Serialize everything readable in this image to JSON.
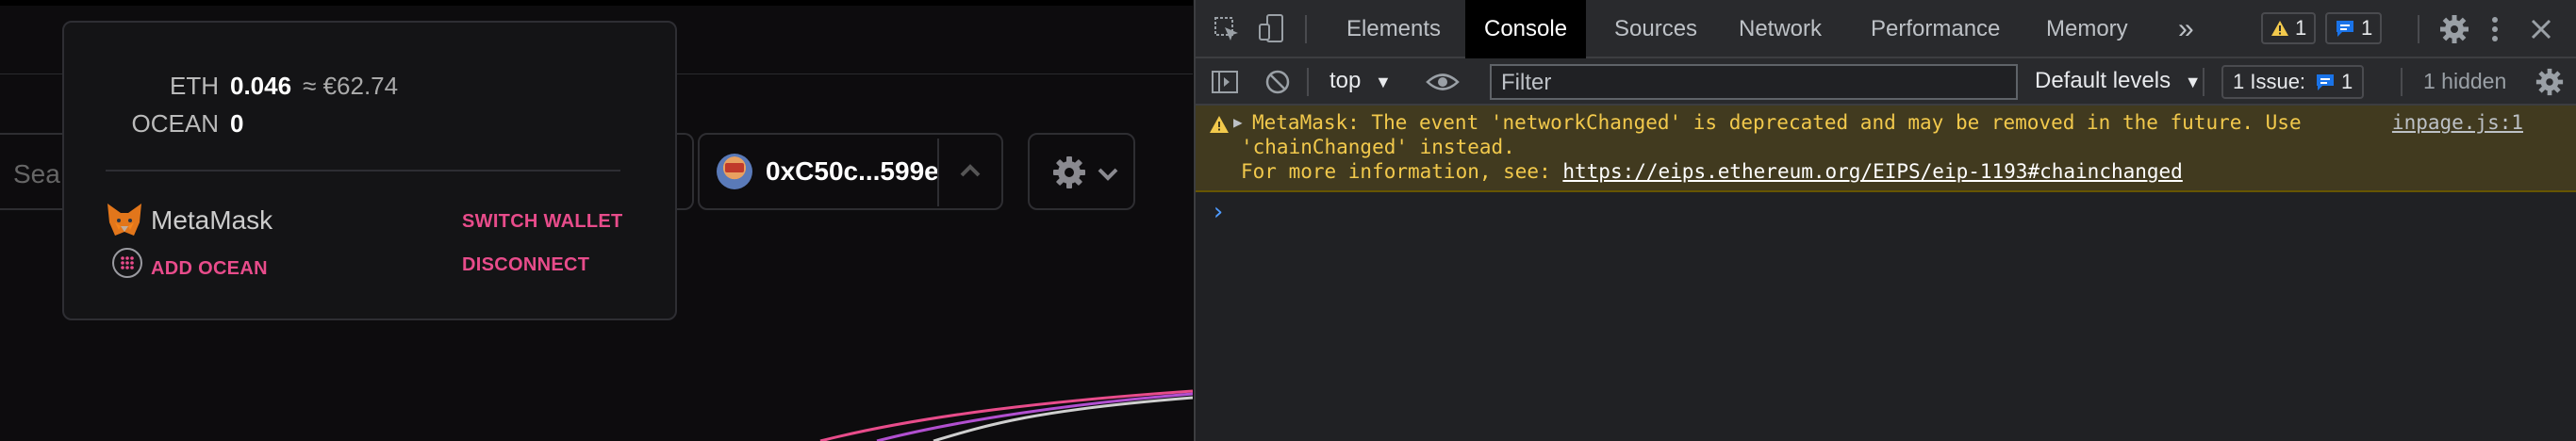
{
  "app": {
    "search_placeholder": "Sea",
    "wallet_button": {
      "address": "0xC50c...599e"
    },
    "wallet_popover": {
      "balances": [
        {
          "symbol": "ETH",
          "amount": "0.046",
          "fiat": "≈ €62.74"
        },
        {
          "symbol": "OCEAN",
          "amount": "0",
          "fiat": ""
        }
      ],
      "provider_name": "MetaMask",
      "add_token_label": "ADD OCEAN",
      "switch_wallet_label": "SWITCH WALLET",
      "disconnect_label": "DISCONNECT"
    },
    "colors": {
      "accent_pink": "#e84c8b",
      "background": "#0d0c0e"
    }
  },
  "devtools": {
    "tabs": [
      "Elements",
      "Console",
      "Sources",
      "Network",
      "Performance",
      "Memory"
    ],
    "active_tab": "Console",
    "more_tabs_label": "»",
    "warnings_count": "1",
    "messages_count": "1",
    "toolbar": {
      "context": "top",
      "filter_placeholder": "Filter",
      "levels": "Default levels",
      "issues_label": "1 Issue:",
      "issues_count": "1",
      "hidden_label": "1 hidden"
    },
    "console": {
      "warning_line1": "MetaMask: The event 'networkChanged' is deprecated and may be removed in the future. Use",
      "warning_line2": "'chainChanged' instead.",
      "warning_line3_prefix": "For more information, see: ",
      "warning_link": "https://eips.ethereum.org/EIPS/eip-1193#chainchanged",
      "source": "inpage.js:1",
      "prompt": "›"
    },
    "colors": {
      "warning_text": "#f2c94c",
      "warning_bg": "#413a1f",
      "issue_blue": "#1a73e8"
    }
  }
}
